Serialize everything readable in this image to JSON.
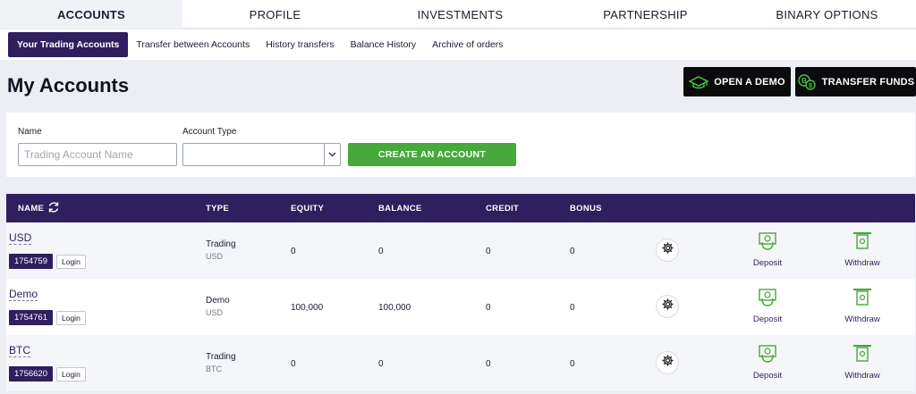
{
  "top_nav": [
    "ACCOUNTS",
    "PROFILE",
    "INVESTMENTS",
    "PARTNERSHIP",
    "BINARY OPTIONS"
  ],
  "sub_nav": [
    "Your Trading Accounts",
    "Transfer between Accounts",
    "History transfers",
    "Balance History",
    "Archive of orders"
  ],
  "page_title": "My Accounts",
  "buttons": {
    "open_demo": "OPEN A DEMO",
    "transfer_funds": "TRANSFER FUNDS",
    "create_account": "CREATE AN ACCOUNT"
  },
  "form": {
    "name_label": "Name",
    "name_placeholder": "Trading Account Name",
    "type_label": "Account Type",
    "type_value": ""
  },
  "table": {
    "columns": [
      "NAME",
      "TYPE",
      "EQUITY",
      "BALANCE",
      "CREDIT",
      "BONUS"
    ],
    "rows": [
      {
        "name": "USD",
        "id": "1754759",
        "login": "Login",
        "type": "Trading",
        "currency": "USD",
        "equity": "0",
        "balance": "0",
        "credit": "0",
        "bonus": "0",
        "deposit": "Deposit",
        "withdraw": "Withdraw"
      },
      {
        "name": "Demo",
        "id": "1754761",
        "login": "Login",
        "type": "Demo",
        "currency": "USD",
        "equity": "100,000",
        "balance": "100,000",
        "credit": "0",
        "bonus": "0",
        "deposit": "Deposit",
        "withdraw": "Withdraw"
      },
      {
        "name": "BTC",
        "id": "1756620",
        "login": "Login",
        "type": "Trading",
        "currency": "BTC",
        "equity": "0",
        "balance": "0",
        "credit": "0",
        "bonus": "0",
        "deposit": "Deposit",
        "withdraw": "Withdraw"
      }
    ]
  },
  "colors": {
    "brand_purple": "#2f1f5e",
    "action_green": "#47a93a",
    "dark_button": "#0b0b0d"
  },
  "icons": [
    "graduation-cap-icon",
    "bitcoin-dollar-icon",
    "chevron-down-icon",
    "refresh-icon",
    "gear-icon",
    "deposit-icon",
    "withdraw-icon"
  ]
}
